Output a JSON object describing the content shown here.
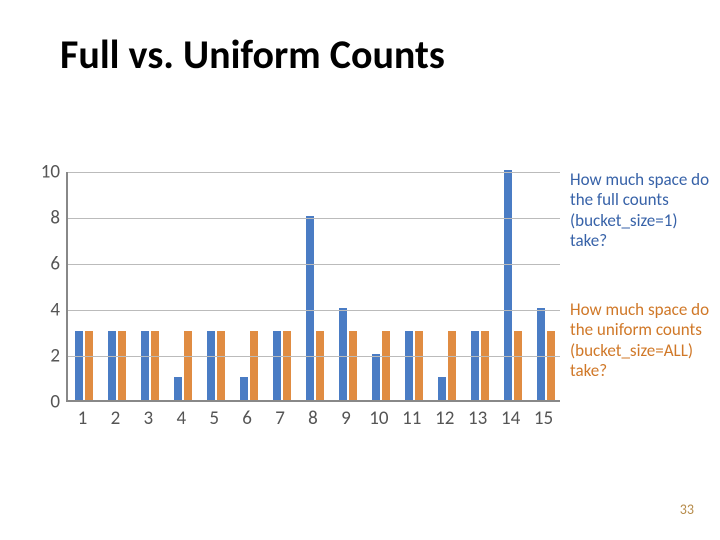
{
  "title": "Full vs. Uniform Counts",
  "annot_blue": "How much space do the full counts (bucket_size=1) take?",
  "annot_orange": "How much space do the uniform counts (bucket_size=ALL) take?",
  "page_number": "33",
  "chart_data": {
    "type": "bar",
    "categories": [
      "1",
      "2",
      "3",
      "4",
      "5",
      "6",
      "7",
      "8",
      "9",
      "10",
      "11",
      "12",
      "13",
      "14",
      "15"
    ],
    "series": [
      {
        "name": "Full counts (bucket_size=1)",
        "values": [
          3,
          3,
          3,
          1,
          3,
          1,
          3,
          8,
          4,
          2,
          3,
          1,
          3,
          10,
          4
        ]
      },
      {
        "name": "Uniform counts (bucket_size=ALL)",
        "values": [
          3,
          3,
          3,
          3,
          3,
          3,
          3,
          3,
          3,
          3,
          3,
          3,
          3,
          3,
          3
        ]
      }
    ],
    "yticks": [
      0,
      2,
      4,
      6,
      8,
      10
    ],
    "ylim": [
      0,
      10
    ],
    "xlabel": "",
    "ylabel": ""
  }
}
